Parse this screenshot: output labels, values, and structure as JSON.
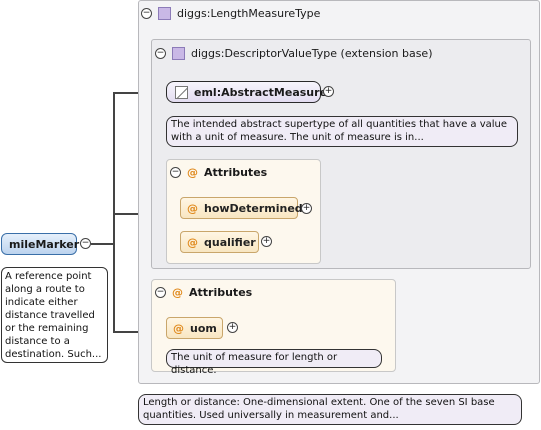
{
  "root": {
    "name": "mileMarker",
    "doc": "A reference point along a route to indicate either distance travelled or the remaining distance to a destination. Such..."
  },
  "type": {
    "name": "diggs:LengthMeasureType",
    "doc": "Length or distance: One-dimensional extent. One of the seven SI base quantities. Used universally in measurement and..."
  },
  "base": {
    "name": "diggs:DescriptorValueType (extension base)"
  },
  "abstract_measure": {
    "name": "eml:AbstractMeasure",
    "doc": "The intended abstract supertype of all quantities that have a value with a unit of measure. The unit of measure is in..."
  },
  "inner_attributes": {
    "label": "Attributes",
    "items": [
      {
        "name": "howDetermined"
      },
      {
        "name": "qualifier"
      }
    ]
  },
  "outer_attributes": {
    "label": "Attributes",
    "items": [
      {
        "name": "uom",
        "doc": "The unit of measure for length or distance."
      }
    ]
  },
  "icons": {
    "collapse": "−",
    "expand": "+",
    "attribute": "@"
  }
}
